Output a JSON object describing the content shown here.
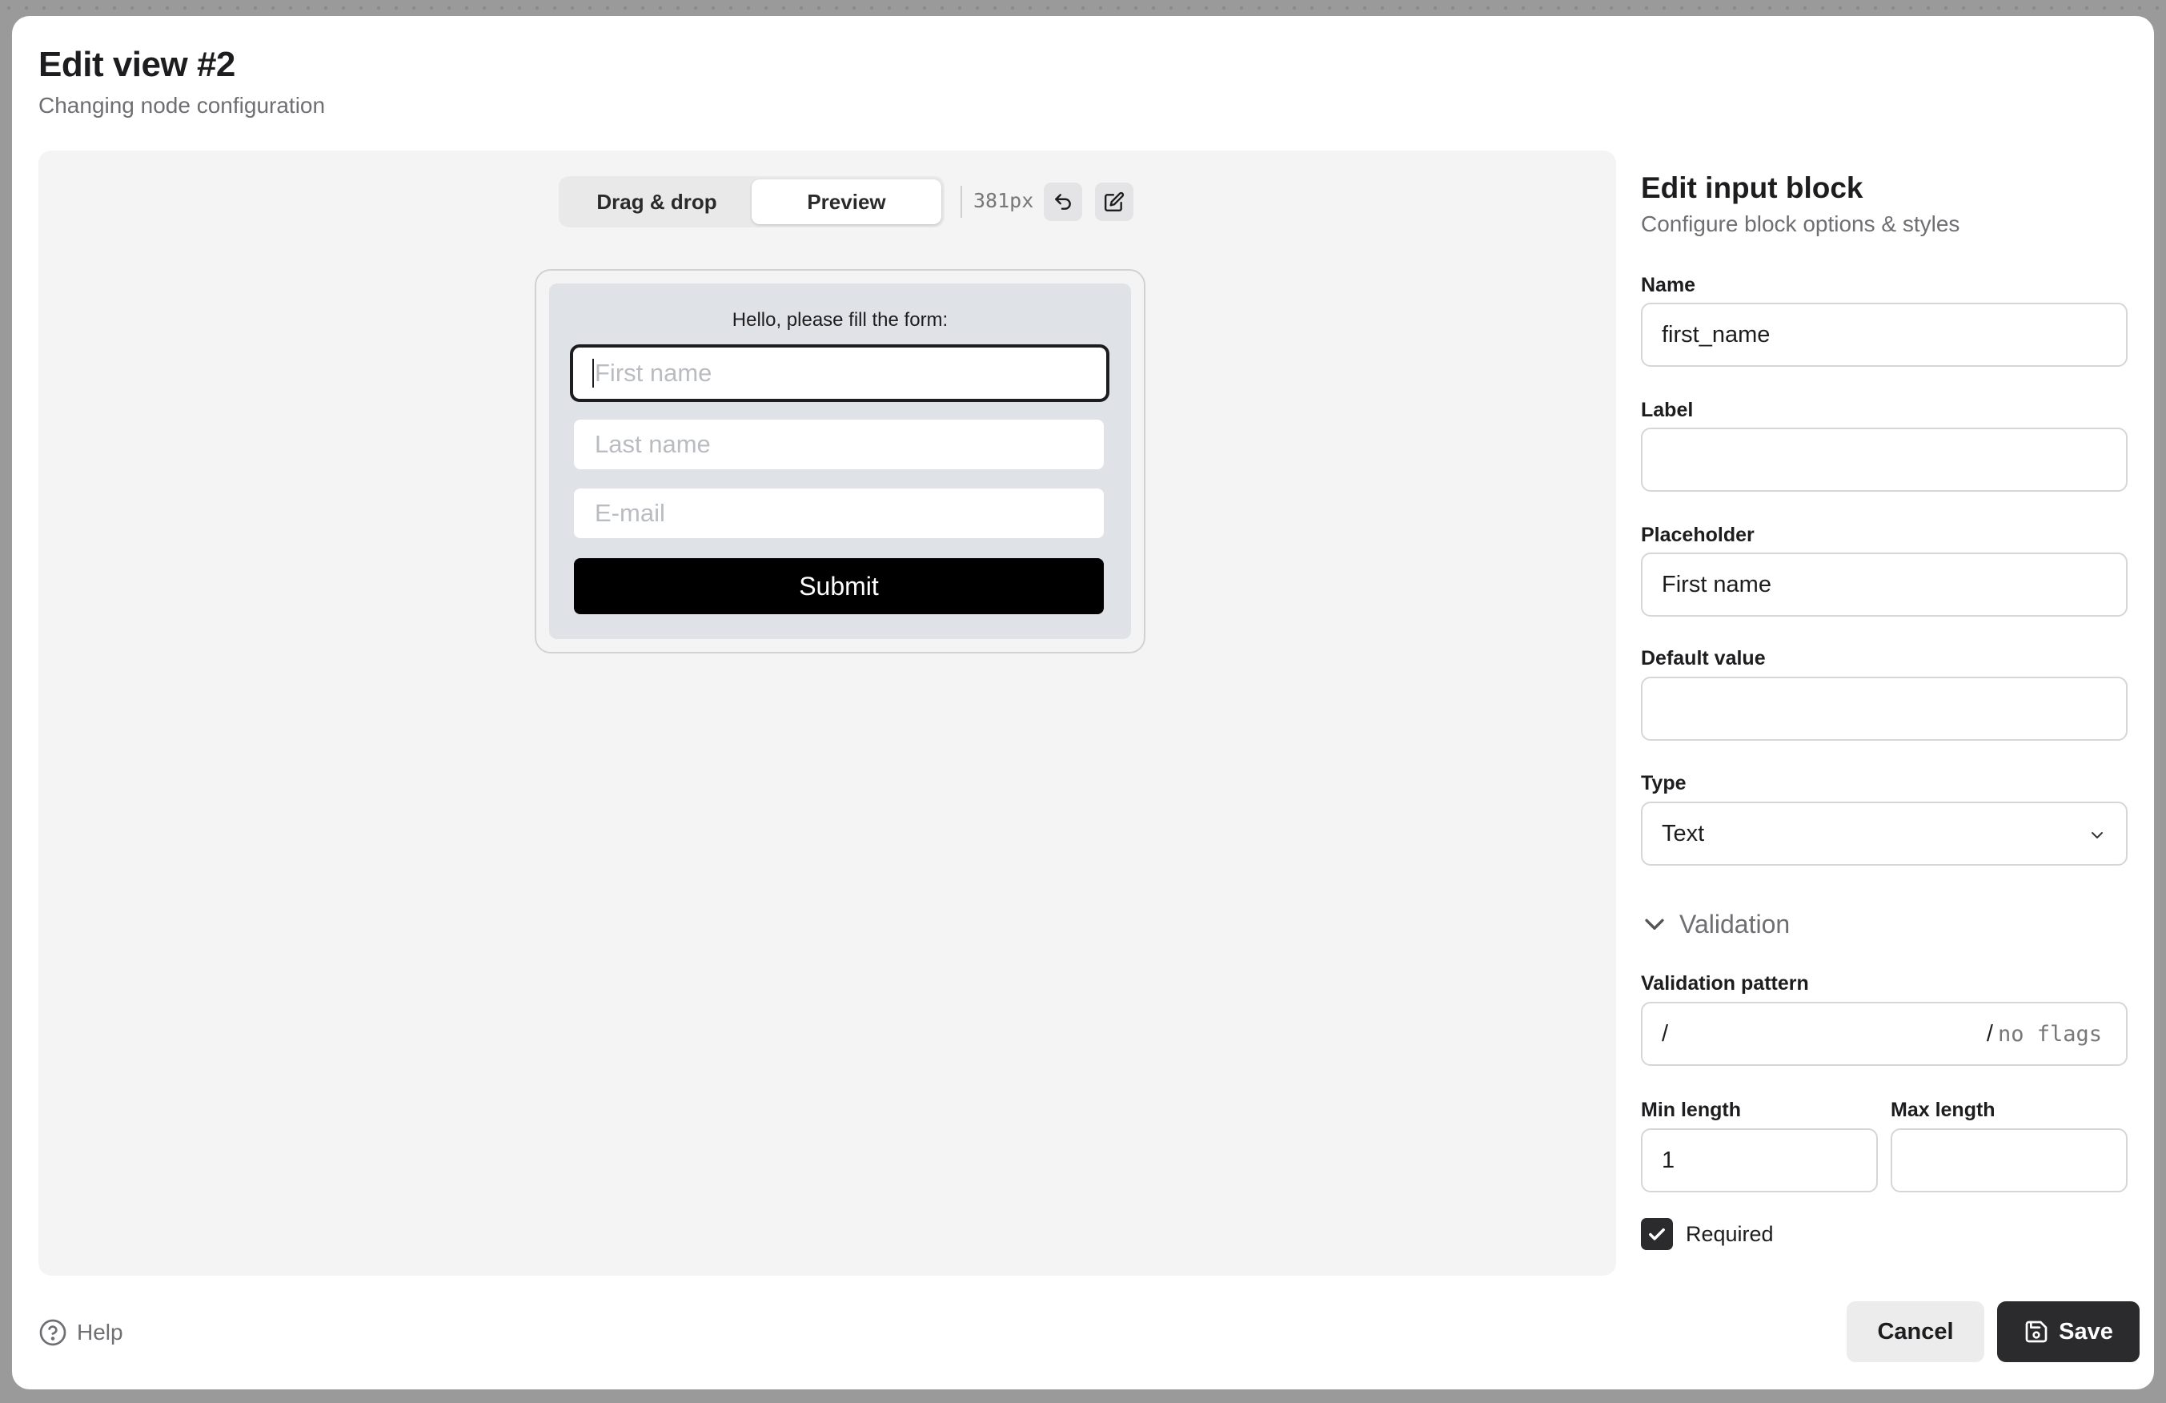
{
  "modal": {
    "title": "Edit view #2",
    "subtitle": "Changing node configuration"
  },
  "toolbar": {
    "tabs": [
      {
        "label": "Drag & drop",
        "active": false
      },
      {
        "label": "Preview",
        "active": true
      }
    ],
    "width_readout": "381px",
    "undo_icon": "undo-arrow-icon",
    "edit_icon": "pencil-edit-icon"
  },
  "preview_form": {
    "heading": "Hello, please fill the form:",
    "inputs": [
      {
        "placeholder": "First name",
        "focused": true
      },
      {
        "placeholder": "Last name",
        "focused": false
      },
      {
        "placeholder": "E-mail",
        "focused": false
      }
    ],
    "submit_label": "Submit"
  },
  "side_panel": {
    "title": "Edit input block",
    "subtitle": "Configure block options & styles",
    "name": {
      "label": "Name",
      "value": "first_name"
    },
    "label_field": {
      "label": "Label",
      "value": ""
    },
    "placeholder": {
      "label": "Placeholder",
      "value": "First name"
    },
    "default_value": {
      "label": "Default value",
      "value": ""
    },
    "type": {
      "label": "Type",
      "value": "Text"
    },
    "validation": {
      "section_label": "Validation",
      "expanded": true,
      "pattern": {
        "label": "Validation pattern",
        "prefix": "/",
        "value": "",
        "suffix": "/",
        "flags_placeholder": "no flags"
      },
      "min_length": {
        "label": "Min length",
        "value": "1"
      },
      "max_length": {
        "label": "Max length",
        "value": ""
      }
    },
    "required": {
      "label": "Required",
      "checked": true
    }
  },
  "footer": {
    "help_label": "Help",
    "cancel_label": "Cancel",
    "save_label": "Save"
  },
  "colors": {
    "backdrop": "#9a9a9a",
    "canvas": "#f4f4f4",
    "form_card": "#dfe3e7",
    "primary_dark": "#2b2b2d",
    "submit": "#000000"
  }
}
